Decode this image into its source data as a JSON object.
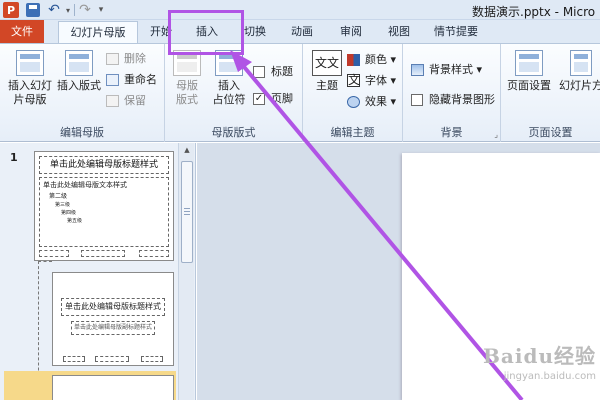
{
  "titlebar": {
    "app_icon": "P",
    "document_title": "数据演示.pptx - Micro",
    "quick_access": [
      "save-icon",
      "undo-icon",
      "redo-icon",
      "customize-icon"
    ]
  },
  "tabs": {
    "file": "文件",
    "slide_master": "幻灯片母版",
    "home": "开始",
    "insert": "插入",
    "transitions": "切换",
    "animations": "动画",
    "review": "审阅",
    "view": "视图",
    "comment": "情节提要"
  },
  "ribbon": {
    "edit_master": {
      "label": "编辑母版",
      "insert_slide_master": [
        "插入幻灯",
        "片母版"
      ],
      "insert_layout": [
        "插入版式"
      ],
      "delete": "删除",
      "rename": "重命名",
      "preserve": "保留"
    },
    "master_layout": {
      "label": "母版版式",
      "master_layout_btn": [
        "母版",
        "版式"
      ],
      "insert_placeholder": [
        "插入",
        "占位符"
      ],
      "title_check": "标题",
      "footer_check": "页脚"
    },
    "edit_theme": {
      "label": "编辑主题",
      "themes": "主题",
      "theme_glyph": "文文",
      "colors": "颜色",
      "fonts": "字体",
      "effects": "效果"
    },
    "background": {
      "label": "背景",
      "background_styles": "背景样式",
      "hide_background": "隐藏背景图形"
    },
    "page_setup": {
      "label": "页面设置",
      "page_setup_btn": "页面设置",
      "slide_orientation": "幻灯片方"
    }
  },
  "slides": {
    "first_number": "1",
    "master_title": "单击此处编辑母版标题样式",
    "master_text": "单击此处编辑母版文本样式",
    "level2": "第二级",
    "level3": "第三级",
    "level4": "第四级",
    "level5": "第五级",
    "layout_title": "单击此处编辑母版标题样式",
    "layout_subtitle": "单击此处编辑母版副标题样式"
  },
  "watermark": {
    "brand": "Baidu经验",
    "url": "jingyan.baidu.com"
  },
  "colors": {
    "highlight": "#b054e5",
    "file_tab": "#d24726",
    "selected_thumb": "#f6d98a"
  }
}
